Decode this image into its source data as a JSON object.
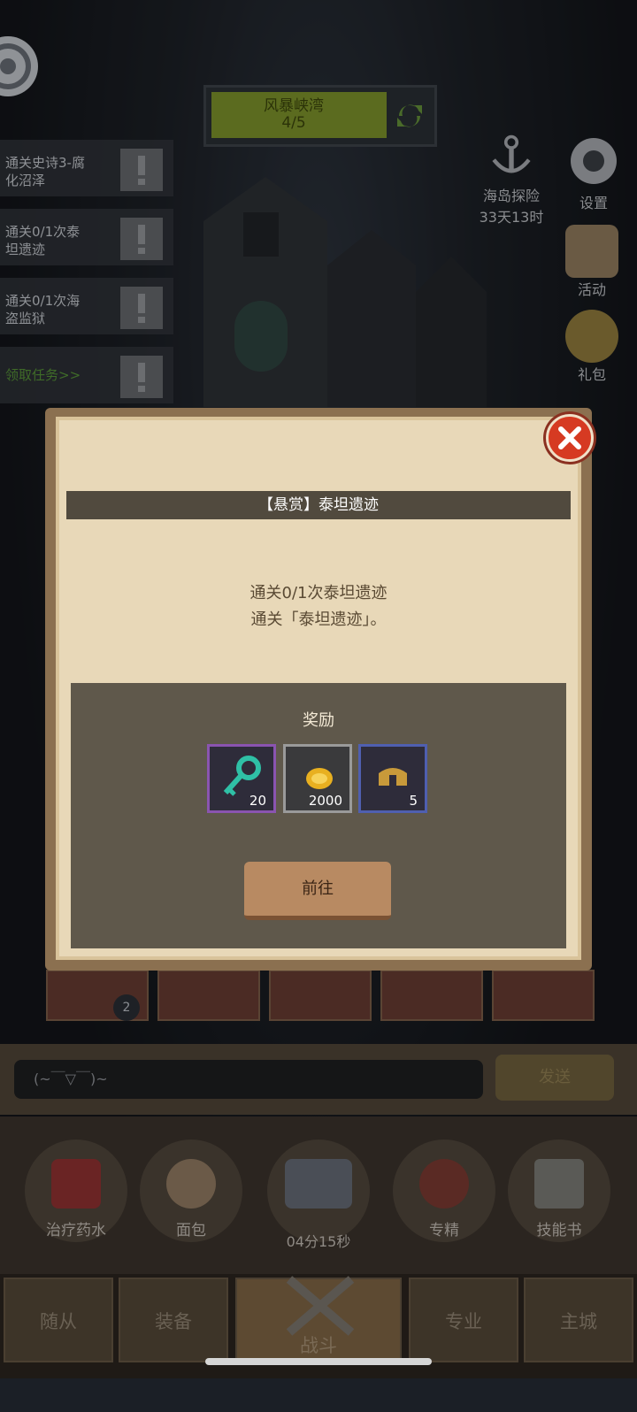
{
  "top": {
    "stage_name": "风暴峡湾",
    "stage_progress": "4/5"
  },
  "quests": [
    {
      "line1": "通关史诗3-腐",
      "line2": "化沼泽"
    },
    {
      "line1": "通关0/1次泰",
      "line2": "坦遗迹"
    },
    {
      "line1": "通关0/1次海",
      "line2": "盗监狱"
    },
    {
      "line1": "领取任务>>",
      "line2": ""
    }
  ],
  "side_menu": {
    "island": "海岛探险",
    "island_timer": "33天13时",
    "settings": "设置",
    "activity": "活动",
    "gift": "礼包"
  },
  "modal": {
    "title": "【悬赏】泰坦遗迹",
    "desc_line1": "通关0/1次泰坦遗迹",
    "desc_line2": "通关「泰坦遗迹」。",
    "reward_title": "奖励",
    "rewards": [
      {
        "icon": "key-icon",
        "count": "20"
      },
      {
        "icon": "gold-coin-icon",
        "count": "2000"
      },
      {
        "icon": "helmet-icon",
        "count": "5"
      }
    ],
    "go_label": "前往"
  },
  "bottom": {
    "tile_badge": "2",
    "chat_placeholder": "(~￣▽￣)~",
    "send_label": "发送",
    "dock": {
      "potion": "治疗药水",
      "bread": "面包",
      "chest_timer": "04分15秒",
      "mastery": "专精",
      "skill_book": "技能书"
    },
    "nav": [
      "随从",
      "装备",
      "战斗",
      "专业",
      "主城"
    ]
  }
}
